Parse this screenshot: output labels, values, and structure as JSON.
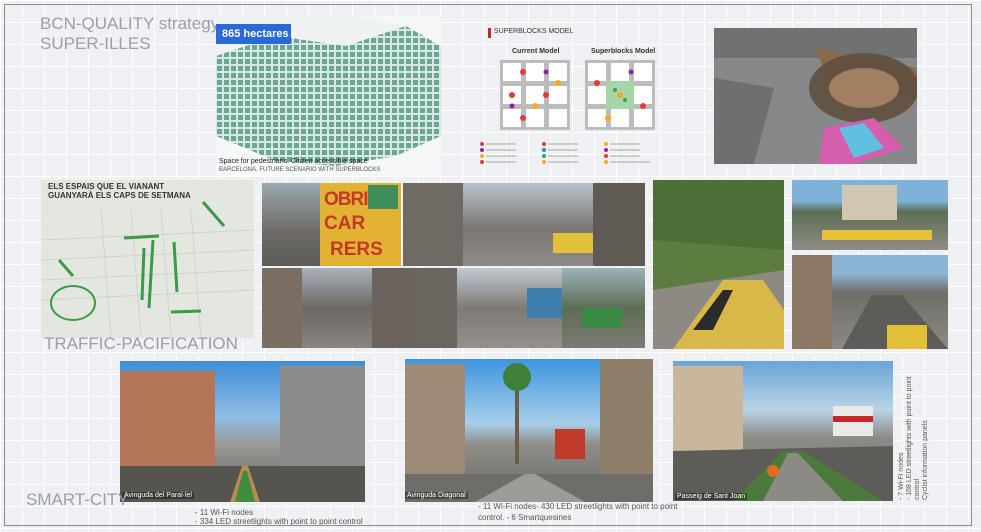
{
  "slide": {
    "title_line1": "BCN-QUALITY strategy:",
    "title_line2": "SUPER-ILLES",
    "section_traffic": "TRAFFIC-PACIFICATION",
    "section_smart": "SMART-CITY"
  },
  "superblock_map": {
    "badge": "865 hectares",
    "caption_line1": "Space for pedestrians. Citizen accessible space",
    "caption_line2": "BARCELONA. FUTURE SCENARIO WITH SUPERBLOCKS"
  },
  "superblocks_model": {
    "title": "SUPERBLOCKS MODEL",
    "left_label": "Current Model",
    "right_label": "Superblocks Model"
  },
  "weekend_map": {
    "title_line1": "ELS ESPAIS QUE EL VIANANT",
    "title_line2": "GUANYARÀ ELS CAPS DE SETMANA"
  },
  "poster": {
    "line1": "OBRIM",
    "line2": "CAR",
    "line3": "RERS"
  },
  "smart_city": {
    "parallel_label": "Avinguda del Paral·lel",
    "parallel_note1": "- 11 Wi-Fi nodes",
    "parallel_note2": "- 334 LED streetlights with point to point control",
    "diagonal_label": "Avinguda Diagonal",
    "diagonal_note1": "- 11 Wi-Fi nodes- 430 LED streetlights with point to point",
    "diagonal_note2": "control. - 6 Smartquesines",
    "santjoan_label": "Passeig de Sant Joan",
    "santjoan_note1": "- 7 Wi-Fi nodes",
    "santjoan_note2": "- 168 LED streetlights with point to point",
    "santjoan_note3": "control",
    "santjoan_note4": "Cyclist information panels"
  },
  "colors": {
    "badge_blue": "#2c69d8",
    "map_green": "#5d9c8d",
    "poster_yellow": "#e4b233",
    "poster_green": "#3d8e5a",
    "slide_bg": "#eef0f3",
    "heading_grey": "#9aa0a6"
  }
}
